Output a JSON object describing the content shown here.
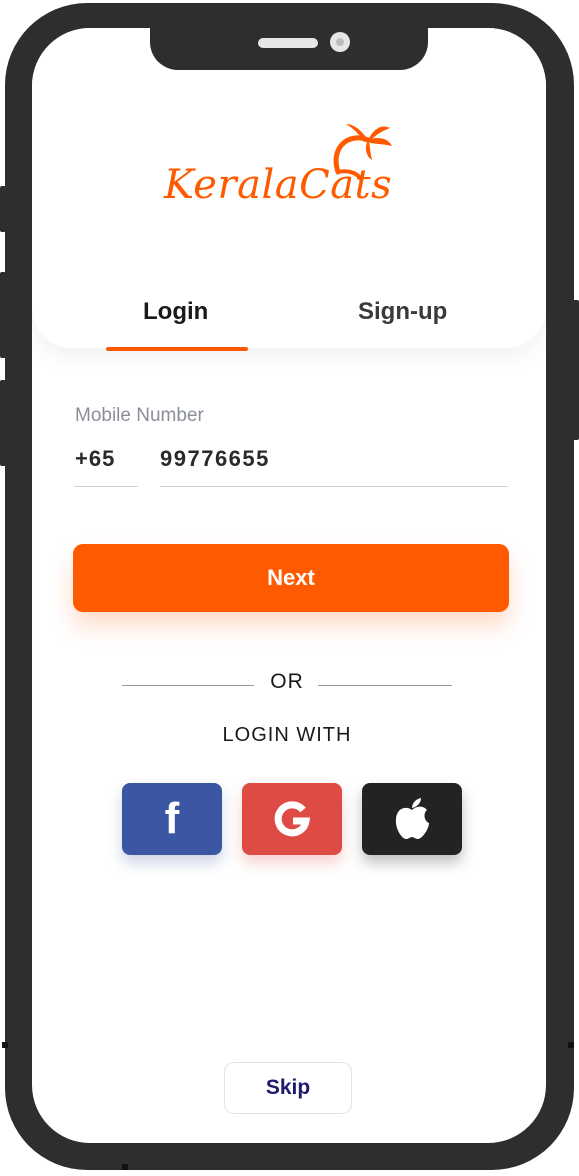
{
  "brand": {
    "name": "KeralaCats",
    "accent_color": "#ff5a00",
    "logo_icon": "palm-leaf-icon"
  },
  "tabs": [
    {
      "label": "Login",
      "active": true
    },
    {
      "label": "Sign-up",
      "active": false
    }
  ],
  "form": {
    "field_label": "Mobile Number",
    "country_code": "+65",
    "phone_number": "99776655",
    "next_label": "Next"
  },
  "divider": {
    "text": "OR"
  },
  "social": {
    "heading": "LOGIN WITH",
    "buttons": [
      {
        "name": "facebook",
        "icon": "facebook-icon",
        "color": "#3b57a3"
      },
      {
        "name": "google",
        "icon": "google-icon",
        "color": "#de4b45"
      },
      {
        "name": "apple",
        "icon": "apple-icon",
        "color": "#232323"
      }
    ]
  },
  "skip_label": "Skip"
}
